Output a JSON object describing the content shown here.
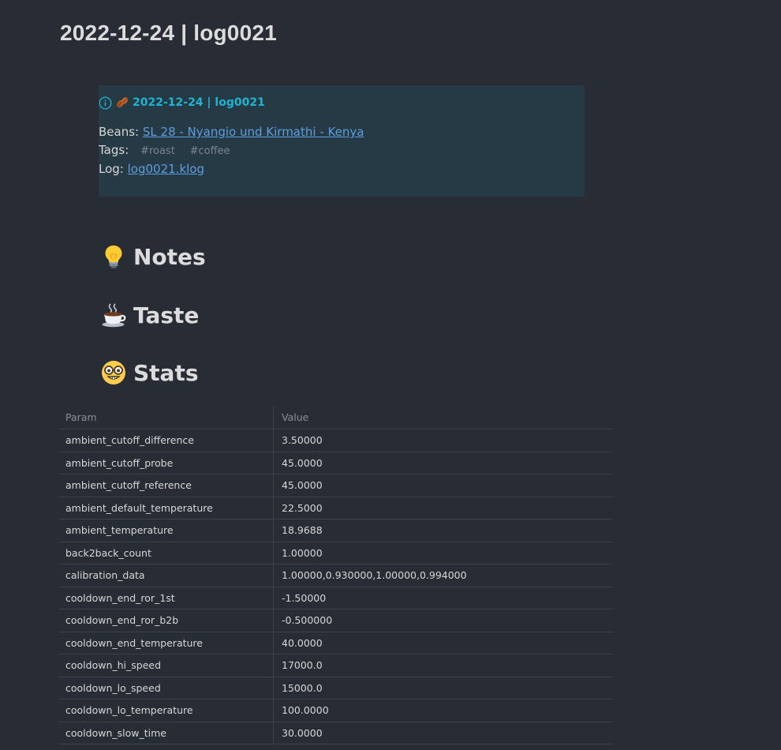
{
  "page": {
    "title": "2022-12-24 | log0021"
  },
  "callout": {
    "info_icon": "info-circle-icon",
    "bean_icon": "coffee-bean-icon",
    "title": "2022-12-24 | log0021",
    "beans_label": "Beans:",
    "beans_link": "SL 28 - Nyangio und Kirmathi - Kenya",
    "tags_label": "Tags:",
    "tags": [
      "#roast",
      "#coffee"
    ],
    "log_label": "Log:",
    "log_link": "log0021.klog",
    "accent_color": "#1fb4d2",
    "background_color": "#253a44"
  },
  "sections": [
    {
      "icon": "light-bulb-icon",
      "title": "Notes"
    },
    {
      "icon": "hot-beverage-icon",
      "title": "Taste"
    },
    {
      "icon": "nerd-face-icon",
      "title": "Stats"
    }
  ],
  "stats_table": {
    "headers": [
      "Param",
      "Value"
    ],
    "rows": [
      [
        "ambient_cutoff_difference",
        "3.50000"
      ],
      [
        "ambient_cutoff_probe",
        "45.0000"
      ],
      [
        "ambient_cutoff_reference",
        "45.0000"
      ],
      [
        "ambient_default_temperature",
        "22.5000"
      ],
      [
        "ambient_temperature",
        "18.9688"
      ],
      [
        "back2back_count",
        "1.00000"
      ],
      [
        "calibration_data",
        "1.00000,0.930000,1.00000,0.994000"
      ],
      [
        "cooldown_end_ror_1st",
        "-1.50000"
      ],
      [
        "cooldown_end_ror_b2b",
        "-0.500000"
      ],
      [
        "cooldown_end_temperature",
        "40.0000"
      ],
      [
        "cooldown_hi_speed",
        "17000.0"
      ],
      [
        "cooldown_lo_speed",
        "15000.0"
      ],
      [
        "cooldown_lo_temperature",
        "100.0000"
      ],
      [
        "cooldown_slow_time",
        "30.0000"
      ]
    ]
  }
}
